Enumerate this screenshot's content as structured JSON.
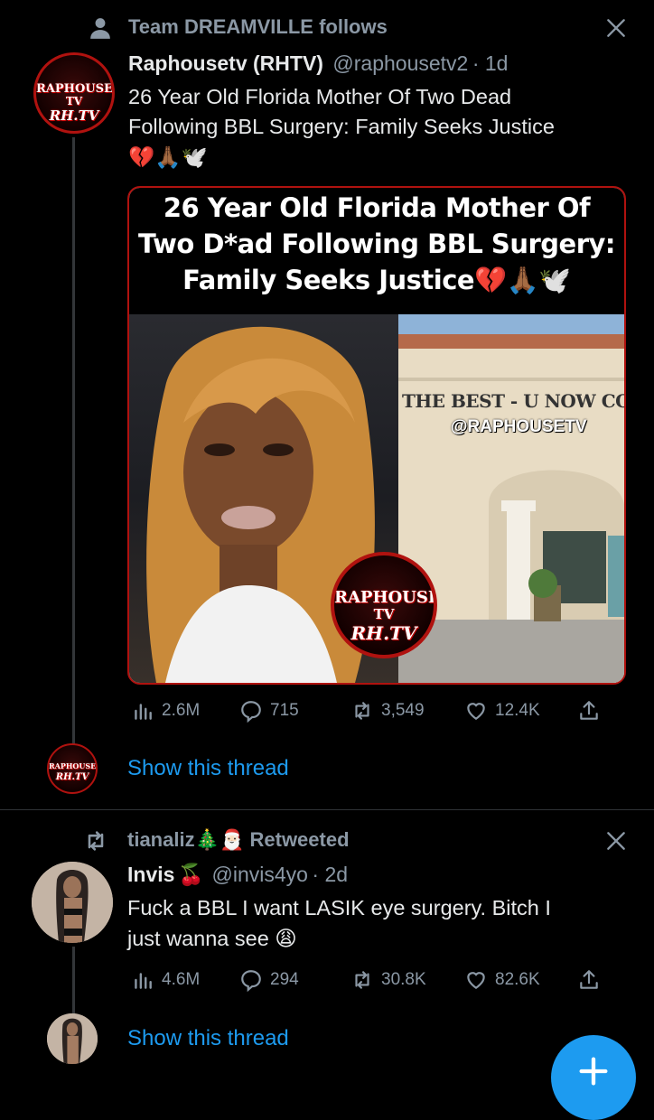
{
  "tweet1": {
    "social_context": "Team DREAMVILLE follows",
    "display_name": "Raphousetv (RHTV)",
    "handle": "@raphousetv2",
    "time": "· 1d",
    "text_line1": "26 Year Old Florida Mother Of Two Dead",
    "text_line2": "Following BBL Surgery: Family Seeks Justice",
    "text_emoji": "💔🙏🏾🕊️",
    "avatar_logo": {
      "line1": "RAPHOUSE",
      "line2": "TV",
      "line3": "RH.TV"
    },
    "media": {
      "headline_line1": "26 Year Old Florida Mother Of",
      "headline_line2": "Two D*ad Following BBL Surgery:",
      "headline_line3": "Family Seeks Justice💔🙏🏾🕊️",
      "building_sign": "THE BEST - U NOW CO",
      "watermark": "@RAPHOUSETV",
      "logo": {
        "line1": "RAPHOUSE",
        "line2": "TV",
        "line3": "RH.TV"
      }
    },
    "stats": {
      "views": "2.6M",
      "replies": "715",
      "retweets": "3,549",
      "likes": "12.4K"
    },
    "show_thread": "Show this thread"
  },
  "tweet2": {
    "social_context_name": "tianaliz",
    "social_context_emoji": "🎄🎅🏻",
    "social_context_action": "Retweeted",
    "display_name": "Invis",
    "name_emoji": "🍒",
    "handle": "@invis4yo",
    "time": "· 2d",
    "text_line1": "Fuck a BBL I want LASIK eye surgery. Bitch I",
    "text_line2": "just wanna see 😩",
    "stats": {
      "views": "4.6M",
      "replies": "294",
      "retweets": "30.8K",
      "likes": "82.6K"
    },
    "show_thread": "Show this thread"
  },
  "fab": {
    "icon": "compose-plus-icon",
    "color": "#1d9bf0"
  },
  "colors": {
    "accent": "#1d9bf0",
    "muted": "#8b98a5",
    "logo_red": "#b0120f"
  }
}
